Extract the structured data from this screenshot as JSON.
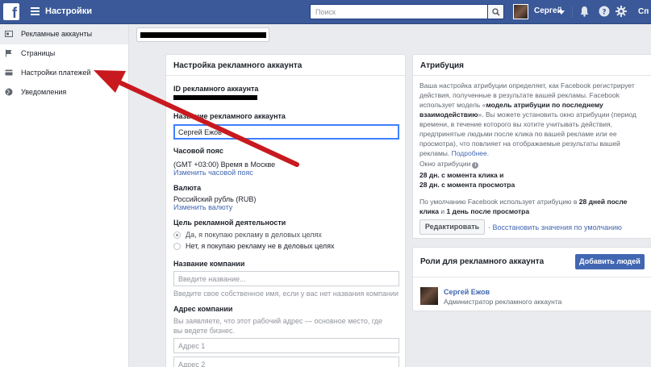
{
  "topbar": {
    "logo": "f",
    "title": "Настройки",
    "search_placeholder": "Поиск",
    "user_name": "Сергей",
    "help_label": "Сп",
    "icons": [
      "menu-icon",
      "search-icon",
      "caret-down-icon",
      "bell-icon",
      "question-icon",
      "gear-icon"
    ]
  },
  "sidebar": {
    "items": [
      {
        "label": "Рекламные аккаунты",
        "icon": "ad-account-icon",
        "active": true
      },
      {
        "label": "Страницы",
        "icon": "flag-icon"
      },
      {
        "label": "Настройки платежей",
        "icon": "card-icon"
      },
      {
        "label": "Уведомления",
        "icon": "globe-icon"
      }
    ]
  },
  "account_settings": {
    "title": "Настройка рекламного аккаунта",
    "id_label": "ID рекламного аккаунта",
    "name_label": "Название рекламного аккаунта",
    "name_value": "Сергей Ежов",
    "timezone_label": "Часовой пояс",
    "timezone_value": "(GMT +03:00) Время в Москве",
    "timezone_link": "Изменить часовой пояс",
    "currency_label": "Валюта",
    "currency_value": "Российский рубль (RUB)",
    "currency_link": "Изменить валюту",
    "purpose_label": "Цель рекламной деятельности",
    "purpose_options": [
      "Да, я покупаю рекламу в деловых целях",
      "Нет, я покупаю рекламу не в деловых целях"
    ],
    "company_label": "Название компании",
    "company_placeholder": "Введите название...",
    "company_hint": "Введите свое собственное имя, если у вас нет названия компании",
    "address_label": "Адрес компании",
    "address_hint": "Вы заявляете, что этот рабочий адрес — основное место, где вы ведете бизнес.",
    "address1_placeholder": "Адрес 1",
    "address2_placeholder": "Адрес 2"
  },
  "attribution": {
    "title": "Атрибуция",
    "desc_1": "Ваша настройка атрибуции определяет, как Facebook регистрирует действия, полученные в результате вашей рекламы. Facebook использует модель «",
    "desc_bold": "модель атрибуции по последнему взаимодействию",
    "desc_2": "». Вы можете установить окно атрибуции (период времени, в течение которого вы хотите учитывать действия, предпринятые людьми после клика по вашей рекламе или ее просмотра), что повлияет на отображаемые результаты вашей рекламы.",
    "more_link": "Подробнее.",
    "window_label": "Окно атрибуции",
    "window_line1": "28 дн. с момента клика и",
    "window_line2": "28 дн. с момента просмотра",
    "default_1": "По умолчанию Facebook использует атрибуцию в ",
    "default_b1": "28 дней после клика",
    "default_2": " и ",
    "default_b2": "1 день после просмотра",
    "edit_button": "Редактировать",
    "restore_link": "· Восстановить значения по умолчанию"
  },
  "roles": {
    "title": "Роли для рекламного аккаунта",
    "add_button": "Добавить людей",
    "person_name": "Сергей Ежов",
    "person_role": "Администратор рекламного аккаунта"
  },
  "colors": {
    "brand": "#3b5998",
    "link": "#4267b2",
    "annotation_arrow": "#c8191f"
  }
}
